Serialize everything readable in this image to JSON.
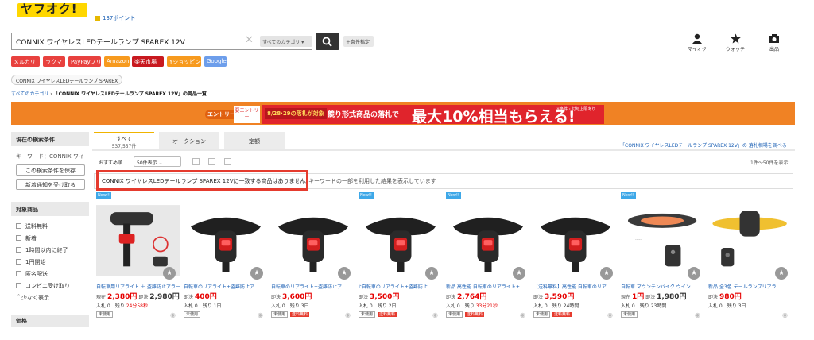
{
  "header": {
    "logo_text": "ヤフオク!",
    "points": "137ポイント",
    "search_value": "CONNIX ワイヤレスLEDテールランプ SPAREX 12V",
    "category_select": "すべてのカテゴリ",
    "condition_button": "＋条件指定",
    "icons": [
      {
        "name": "myauction-icon",
        "label": "マイオク"
      },
      {
        "name": "watch-star-icon",
        "label": "ウォッチ"
      },
      {
        "name": "camera-icon",
        "label": "出品"
      }
    ]
  },
  "malls": [
    {
      "label": "メルカリ",
      "color": "#e8413e"
    },
    {
      "label": "ラクマ",
      "color": "#e8413e"
    },
    {
      "label": "PayPayフリマ",
      "color": "#e8413e"
    },
    {
      "label": "Amazon",
      "color": "#f79a1e"
    },
    {
      "label": "楽天市場",
      "color": "#c8191f"
    },
    {
      "label": "Yショッピング",
      "color": "#f79a1e"
    },
    {
      "label": "Google",
      "color": "#6d9eeb"
    }
  ],
  "chip": "CONNIX ワイヤレスLEDテールランプ SPAREX",
  "breadcrumb": {
    "root": "すべてのカテゴリ",
    "sep": "›",
    "current": "「CONNIX ワイヤレスLEDテールランプ SPAREX 12V」の商品一覧"
  },
  "banner": {
    "campaign": "エントリー",
    "entry": "要エントリー",
    "date": "8/28·29の落札が対象",
    "text": "競り形式商品の落札で",
    "pct": "最大10%相当もらえる!",
    "note": "※条件・付与上限あり"
  },
  "sidebar": {
    "current_title": "現在の検索条件",
    "keyword": "キーワード：CONNIX ワイー",
    "save_button": "この検索条件を保存",
    "notify_button": "新着通知を受け取る",
    "filter_title": "対象商品",
    "filters": [
      "送料無料",
      "新着",
      "1時間以内に終了",
      "1円開始",
      "匿名配送",
      "コンビニ受け取り"
    ],
    "less": "＾少なく表示",
    "next_title": "価格"
  },
  "tabs": [
    {
      "label": "すべて",
      "count": "537,557件"
    },
    {
      "label": "オークション",
      "count": ""
    },
    {
      "label": "定額",
      "count": ""
    }
  ],
  "market_link": "「CONNIX ワイヤレスLEDテールランプ SPAREX 12V」の 落札相場を調べる",
  "sort": {
    "label": "おすすめ順",
    "per_page": "50件表示",
    "range": "1件〜50件を表示"
  },
  "message": {
    "main": "CONNIX ワイヤレスLEDテールランプ SPAREX 12Vに一致する商品はありません。",
    "sub": "キーワードの一部を利用した結果を表示しています"
  },
  "products": [
    {
      "new": "New!!",
      "title": "自転車用リアライト ＋ 盗難防止アラー…",
      "p1l": "現在",
      "p1": "2,380円",
      "p2l": "即決",
      "p2": "2,980円",
      "bids": "入札 0",
      "left": "残り",
      "time": "24分58秒",
      "urgent": true,
      "tag": "未使用",
      "tag2": ""
    },
    {
      "new": "",
      "title": "自転車のリアライト+盗難防止ア…",
      "p1l": "即決",
      "p1": "400円",
      "p2l": "",
      "p2": "",
      "bids": "入札 0",
      "left": "残り",
      "time": "1日",
      "urgent": false,
      "tag": "未使用",
      "tag2": ""
    },
    {
      "new": "",
      "title": "自転車のリアライト+盗難防止ア…",
      "p1l": "即決",
      "p1": "3,600円",
      "p2l": "",
      "p2": "",
      "bids": "入札 0",
      "left": "残り",
      "time": "3日",
      "urgent": false,
      "tag": "未使用",
      "tag2": "送料無料"
    },
    {
      "new": "New!!",
      "title": "♪自転車のリアライト+盗難防止…",
      "p1l": "即決",
      "p1": "3,500円",
      "p2l": "",
      "p2": "",
      "bids": "入札 0",
      "left": "残り",
      "time": "2日",
      "urgent": false,
      "tag": "未使用",
      "tag2": "送料無料"
    },
    {
      "new": "New!!",
      "title": "新品 高性能 自転車のリアライト+…",
      "p1l": "即決",
      "p1": "2,764円",
      "p2l": "",
      "p2": "",
      "bids": "入札 0",
      "left": "残り",
      "time": "33分21秒",
      "urgent": true,
      "tag": "未使用",
      "tag2": "送料無料"
    },
    {
      "new": "",
      "title": "【送料無料】高性能 自転車のリア…",
      "p1l": "即決",
      "p1": "3,590円",
      "p2l": "",
      "p2": "",
      "bids": "入札 0",
      "left": "残り",
      "time": "24時間",
      "urgent": false,
      "tag": "未使用",
      "tag2": "送料無料"
    },
    {
      "new": "New!!",
      "title": "自転車 マウンテンバイク ウイン…",
      "p1l": "現在",
      "p1": "1円",
      "p2l": "即決",
      "p2": "1,980円",
      "bids": "入札 0",
      "left": "残り",
      "time": "23時間",
      "urgent": false,
      "tag": "未使用",
      "tag2": ""
    },
    {
      "new": "",
      "title": "新品 全3色 テールランプリアラ…",
      "p1l": "即決",
      "p1": "980円",
      "p2l": "",
      "p2": "",
      "bids": "入札 0",
      "left": "残り",
      "time": "3日",
      "urgent": false,
      "tag": "",
      "tag2": ""
    }
  ]
}
